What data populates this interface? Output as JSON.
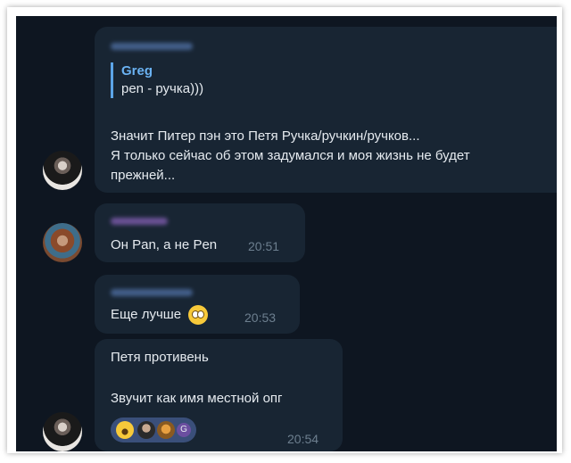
{
  "messages": [
    {
      "quote_author": "Greg",
      "quote_text": "pen - ручка)))",
      "lines": [
        "Значит Питер пэн это Петя Ручка/ручкин/ручков...",
        "Я только сейчас об этом задумался и моя жизнь не будет",
        "прежней..."
      ]
    },
    {
      "text": "Он Pan, а не Pen",
      "time": "20:51"
    },
    {
      "text": "Еще лучше",
      "emoji": "rolling-eyes-emoji",
      "time": "20:53"
    },
    {
      "line1": "Петя противень",
      "line2": "Звучит как имя местной опг",
      "time": "20:54",
      "reaction_emoji": "grinning-face-emoji",
      "reaction_count_label": "G"
    }
  ],
  "colors": {
    "background": "#0e1621",
    "bubble": "#182533",
    "accent": "#6ab2f2",
    "time": "#6d7f8f"
  }
}
